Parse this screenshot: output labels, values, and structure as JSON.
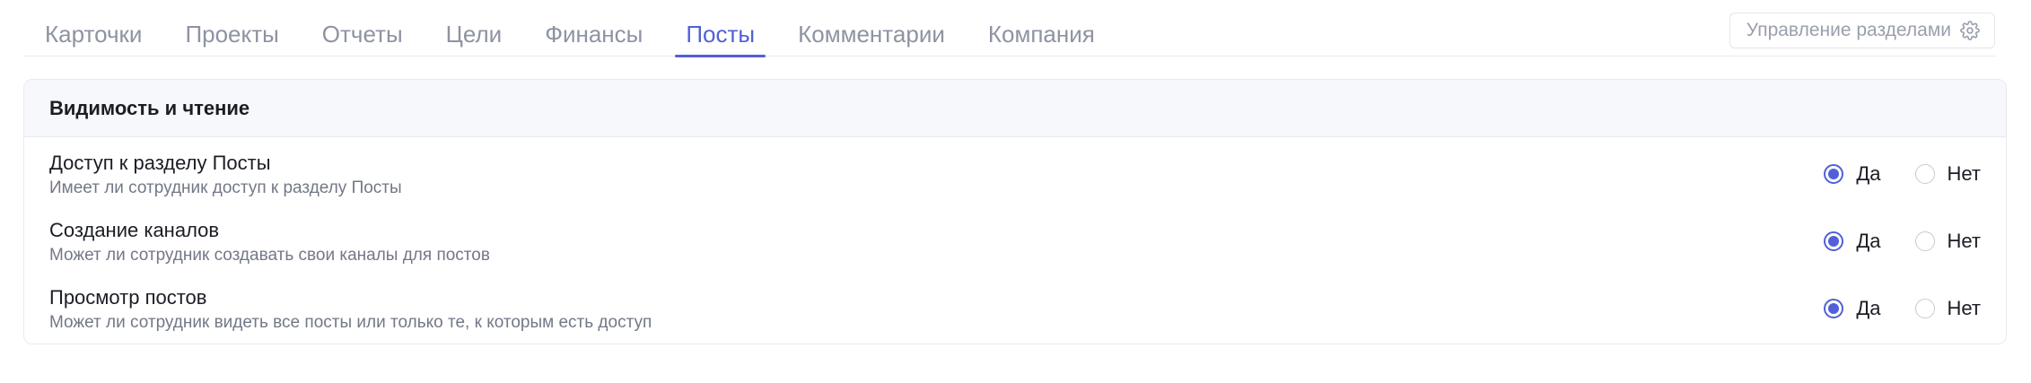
{
  "tabs": [
    {
      "label": "Карточки",
      "active": false
    },
    {
      "label": "Проекты",
      "active": false
    },
    {
      "label": "Отчеты",
      "active": false
    },
    {
      "label": "Цели",
      "active": false
    },
    {
      "label": "Финансы",
      "active": false
    },
    {
      "label": "Посты",
      "active": true
    },
    {
      "label": "Комментарии",
      "active": false
    },
    {
      "label": "Компания",
      "active": false
    }
  ],
  "manage_button": {
    "label": "Управление разделами",
    "icon": "gear-icon"
  },
  "section": {
    "title": "Видимость и чтение",
    "rows": [
      {
        "title": "Доступ к разделу Посты",
        "description": "Имеет ли сотрудник доступ к разделу Посты",
        "yes_label": "Да",
        "no_label": "Нет",
        "value": "yes"
      },
      {
        "title": "Создание каналов",
        "description": "Может ли сотрудник создавать свои каналы для постов",
        "yes_label": "Да",
        "no_label": "Нет",
        "value": "yes"
      },
      {
        "title": "Просмотр постов",
        "description": "Может ли сотрудник видеть все посты или только те, к которым есть доступ",
        "yes_label": "Да",
        "no_label": "Нет",
        "value": "yes"
      }
    ]
  },
  "colors": {
    "accent": "#5160d6",
    "tab_inactive": "#8e93a2",
    "header_bg": "#f7f8fc",
    "border": "#e8eaef"
  }
}
